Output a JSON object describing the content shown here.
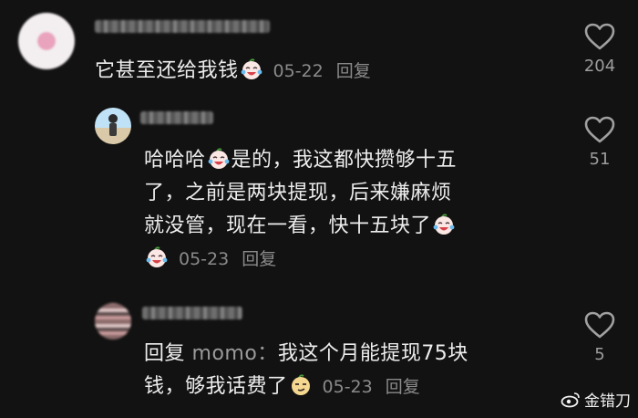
{
  "comments": [
    {
      "text": "它甚至还给我钱",
      "date": "05-22",
      "reply": "回复",
      "likes": "204",
      "emoji": "crying-laughing-emoji"
    },
    {
      "line1": "哈哈哈",
      "line1b": "是的，我这都快攒够十五",
      "line2": "了，之前是两块提现，后来嫌麻烦",
      "line3": "就没管，现在一看，快十五块了",
      "date": "05-23",
      "reply": "回复",
      "likes": "51",
      "emoji": "crying-laughing-emoji"
    },
    {
      "reply_prefix": "回复",
      "mention": "momo：",
      "line1": "我这个月能提现75块",
      "line2": "钱，够我话费了",
      "date": "05-23",
      "reply": "回复",
      "likes": "5",
      "emoji": "smirking-face-emoji"
    }
  ],
  "watermark": "金错刀",
  "colors": {
    "background": "#121212",
    "text": "#ededed",
    "meta": "#8a8a8a"
  }
}
